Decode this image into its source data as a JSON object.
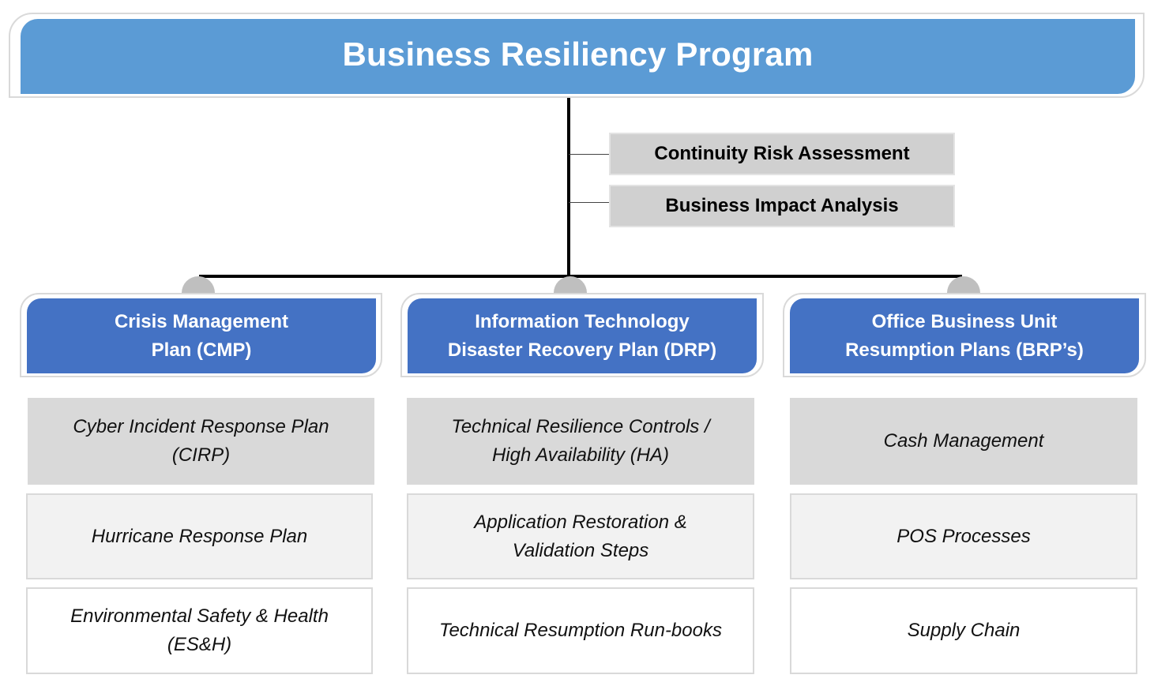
{
  "header": {
    "title": "Business Resiliency Program"
  },
  "assessments": [
    {
      "label": "Continuity Risk Assessment"
    },
    {
      "label": "Business Impact Analysis"
    }
  ],
  "plans": [
    {
      "title_line1": "Crisis Management",
      "title_line2": "Plan (CMP)",
      "items": [
        {
          "line1": "Cyber Incident Response Plan",
          "line2": "(CIRP)"
        },
        {
          "line1": "Hurricane Response Plan",
          "line2": ""
        },
        {
          "line1": "Environmental Safety & Health",
          "line2": "(ES&H)"
        }
      ]
    },
    {
      "title_line1": "Information Technology",
      "title_line2": "Disaster Recovery Plan (DRP)",
      "items": [
        {
          "line1": "Technical Resilience Controls /",
          "line2": "High Availability (HA)"
        },
        {
          "line1": "Application Restoration &",
          "line2": "Validation Steps"
        },
        {
          "line1": "Technical Resumption Run-books",
          "line2": ""
        }
      ]
    },
    {
      "title_line1": "Office Business Unit",
      "title_line2": "Resumption Plans (BRP’s)",
      "items": [
        {
          "line1": "Cash Management",
          "line2": ""
        },
        {
          "line1": "POS Processes",
          "line2": ""
        },
        {
          "line1": "Supply Chain",
          "line2": ""
        }
      ]
    }
  ],
  "colors": {
    "header_blue": "#5b9bd5",
    "plan_blue": "#4472c4",
    "assessment_gray": "#d0d0d0",
    "item_dark_gray": "#d9d9d9",
    "item_light_gray": "#f2f2f2",
    "connector": "#000000",
    "knob_gray": "#bfbfbf"
  }
}
